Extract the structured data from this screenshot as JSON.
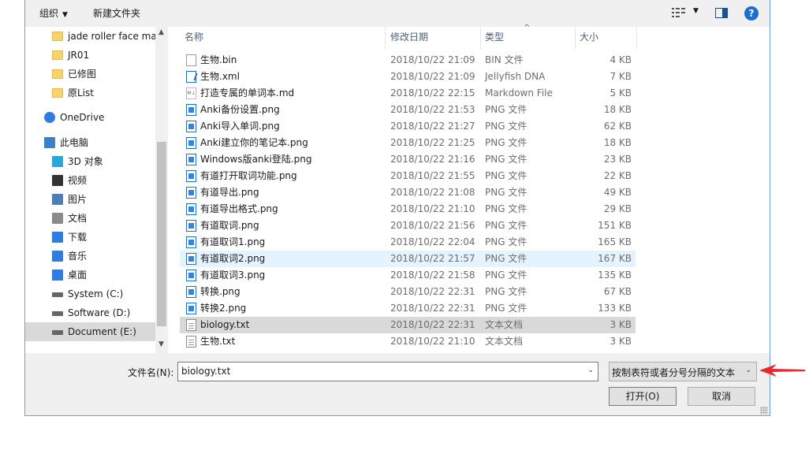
{
  "toolbar": {
    "organize_label": "组织",
    "new_folder_label": "新建文件夹"
  },
  "nav": {
    "items": [
      {
        "label": "jade roller face ma",
        "icon": "folder-icon"
      },
      {
        "label": "JR01",
        "icon": "folder-icon"
      },
      {
        "label": "已修图",
        "icon": "folder-icon"
      },
      {
        "label": "原List",
        "icon": "folder-icon"
      },
      {
        "label": "OneDrive",
        "icon": "onedrive-icon"
      },
      {
        "label": "此电脑",
        "icon": "computer-icon"
      },
      {
        "label": "3D 对象",
        "icon": "3d-objects-icon"
      },
      {
        "label": "视频",
        "icon": "video-icon"
      },
      {
        "label": "图片",
        "icon": "pictures-icon"
      },
      {
        "label": "文档",
        "icon": "documents-icon"
      },
      {
        "label": "下载",
        "icon": "download-icon"
      },
      {
        "label": "音乐",
        "icon": "music-icon"
      },
      {
        "label": "桌面",
        "icon": "desktop-icon"
      },
      {
        "label": "System (C:)",
        "icon": "drive-icon"
      },
      {
        "label": "Software (D:)",
        "icon": "drive-icon"
      },
      {
        "label": "Document (E:)",
        "icon": "drive-icon",
        "selected": true
      }
    ]
  },
  "columns": {
    "name": "名称",
    "date": "修改日期",
    "type": "类型",
    "size": "大小"
  },
  "files": [
    {
      "name": "生物.bin",
      "date": "2018/10/22 21:09",
      "type": "BIN 文件",
      "size": "4 KB",
      "icon": "bin"
    },
    {
      "name": "生物.xml",
      "date": "2018/10/22 21:09",
      "type": "Jellyfish DNA",
      "size": "7 KB",
      "icon": "xml"
    },
    {
      "name": "打造专属的单词本.md",
      "date": "2018/10/22 22:15",
      "type": "Markdown File",
      "size": "5 KB",
      "icon": "md"
    },
    {
      "name": "Anki备份设置.png",
      "date": "2018/10/22 21:53",
      "type": "PNG 文件",
      "size": "18 KB",
      "icon": "png"
    },
    {
      "name": "Anki导入单词.png",
      "date": "2018/10/22 21:27",
      "type": "PNG 文件",
      "size": "62 KB",
      "icon": "png"
    },
    {
      "name": "Anki建立你的笔记本.png",
      "date": "2018/10/22 21:25",
      "type": "PNG 文件",
      "size": "18 KB",
      "icon": "png"
    },
    {
      "name": "Windows版anki登陆.png",
      "date": "2018/10/22 21:16",
      "type": "PNG 文件",
      "size": "23 KB",
      "icon": "png"
    },
    {
      "name": "有道打开取词功能.png",
      "date": "2018/10/22 21:55",
      "type": "PNG 文件",
      "size": "22 KB",
      "icon": "png"
    },
    {
      "name": "有道导出.png",
      "date": "2018/10/22 21:08",
      "type": "PNG 文件",
      "size": "49 KB",
      "icon": "png"
    },
    {
      "name": "有道导出格式.png",
      "date": "2018/10/22 21:10",
      "type": "PNG 文件",
      "size": "29 KB",
      "icon": "png"
    },
    {
      "name": "有道取词.png",
      "date": "2018/10/22 21:56",
      "type": "PNG 文件",
      "size": "151 KB",
      "icon": "png"
    },
    {
      "name": "有道取词1.png",
      "date": "2018/10/22 22:04",
      "type": "PNG 文件",
      "size": "165 KB",
      "icon": "png"
    },
    {
      "name": "有道取词2.png",
      "date": "2018/10/22 21:57",
      "type": "PNG 文件",
      "size": "167 KB",
      "icon": "png",
      "hover": true
    },
    {
      "name": "有道取词3.png",
      "date": "2018/10/22 21:58",
      "type": "PNG 文件",
      "size": "135 KB",
      "icon": "png"
    },
    {
      "name": "转换.png",
      "date": "2018/10/22 22:31",
      "type": "PNG 文件",
      "size": "67 KB",
      "icon": "png"
    },
    {
      "name": "转换2.png",
      "date": "2018/10/22 22:31",
      "type": "PNG 文件",
      "size": "133 KB",
      "icon": "png"
    },
    {
      "name": "biology.txt",
      "date": "2018/10/22 22:31",
      "type": "文本文档",
      "size": "3 KB",
      "icon": "doc",
      "selected": true
    },
    {
      "name": "生物.txt",
      "date": "2018/10/22 21:10",
      "type": "文本文档",
      "size": "3 KB",
      "icon": "doc"
    }
  ],
  "filename": {
    "label": "文件名(N):",
    "value": "biology.txt"
  },
  "filter": {
    "value": "按制表符或者分号分隔的文本"
  },
  "buttons": {
    "open": "打开(O)",
    "cancel": "取消"
  },
  "colors": {
    "dialog_border": "#6f9fd6",
    "selected_row": "#d9d9d9",
    "hover_row": "#e5f3ff",
    "annotation_arrow": "#e8262d"
  }
}
